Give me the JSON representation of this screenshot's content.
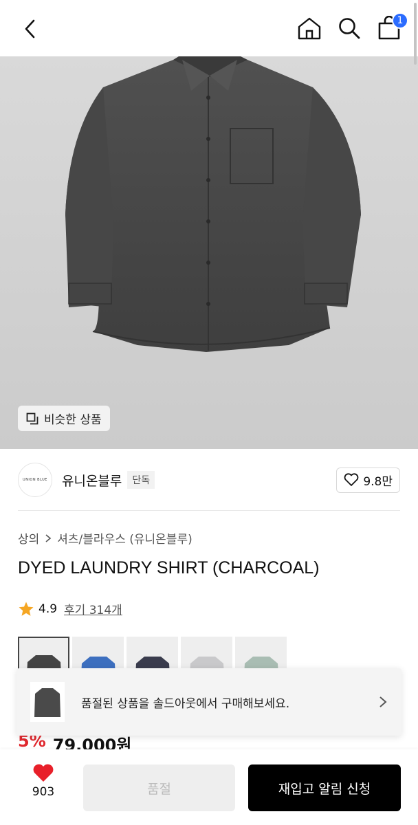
{
  "header": {
    "cart_count": "1"
  },
  "hero": {
    "similar_label": "비슷한 상품"
  },
  "brand": {
    "logo_text": "UNION BLUE",
    "name": "유니온블루",
    "badge": "단독",
    "likes": "9.8만"
  },
  "breadcrumb": {
    "category": "상의",
    "sub": "셔츠/블라우스 (유니온블루)"
  },
  "product": {
    "title": "DYED LAUNDRY SHIRT (CHARCOAL)",
    "rating": "4.9",
    "reviews": "후기 314개",
    "discount": "5%",
    "price": "79,000원"
  },
  "swatches": [
    {
      "color": "#444444",
      "selected": true
    },
    {
      "color": "#3d6fbf",
      "selected": false
    },
    {
      "color": "#3a3c4d",
      "selected": false
    },
    {
      "color": "#c9c9cb",
      "selected": false
    },
    {
      "color": "#a9bdb3",
      "selected": false
    }
  ],
  "toast": {
    "message": "품절된 상품을 솔드아웃에서 구매해보세요."
  },
  "bottom": {
    "wish_count": "903",
    "soldout_label": "품절",
    "notify_label": "재입고 알림 신청"
  },
  "colors": {
    "accent_blue": "#2b6cff",
    "discount_red": "#e0282e",
    "heart_red": "#e8202a",
    "star": "#f5a623"
  }
}
